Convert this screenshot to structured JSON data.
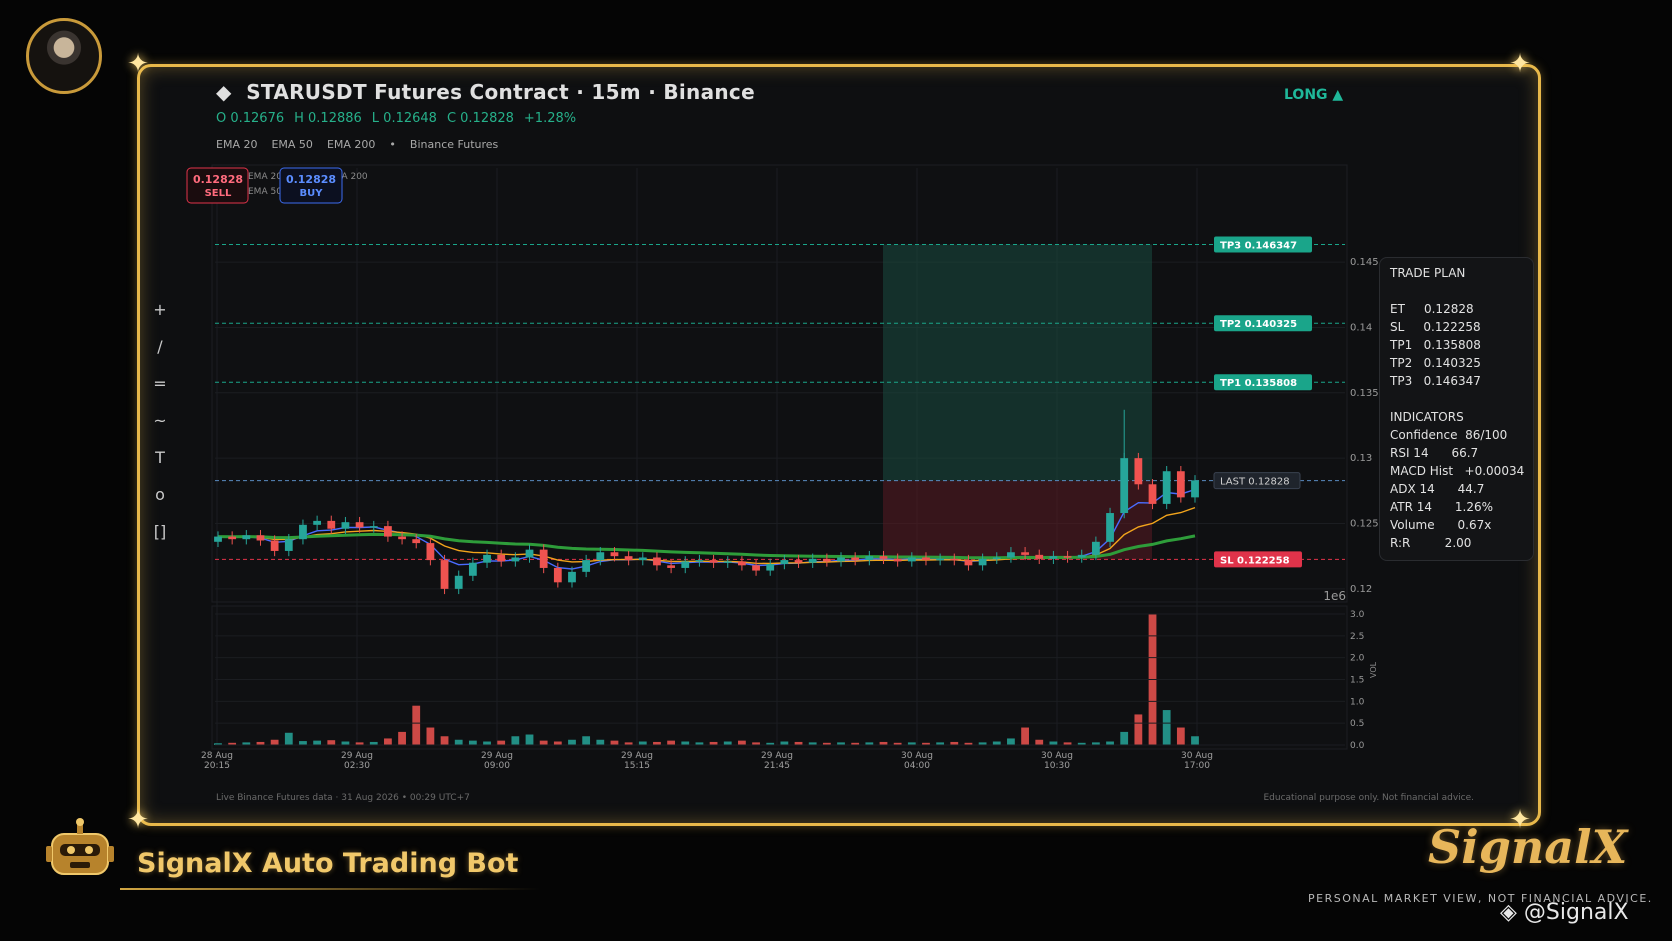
{
  "header": {
    "title": "STARUSDT Futures Contract  ·  15m  ·  Binance",
    "direction": "LONG ▲",
    "ohlc": {
      "o": "O 0.12676",
      "h": "H 0.12886",
      "l": "L 0.12648",
      "c": "C 0.12828",
      "chg": "+1.28%"
    },
    "legend": [
      "EMA 20",
      "EMA 50",
      "EMA 200",
      "•",
      "Binance Futures"
    ]
  },
  "toolbar": [
    "+",
    "/",
    "=",
    "~",
    "T",
    "o",
    "[]"
  ],
  "badges": {
    "sell_price": "0.12828",
    "sell_label": "SELL",
    "buy_price": "0.12828",
    "buy_label": "BUY",
    "ema_small": [
      "EMA 20",
      "EMA 50",
      "EMA 200"
    ]
  },
  "price_levels": {
    "tp3": {
      "label": "TP3  0.146347",
      "value": 0.146347
    },
    "tp2": {
      "label": "TP2  0.140325",
      "value": 0.140325
    },
    "tp1": {
      "label": "TP1  0.135808",
      "value": 0.135808
    },
    "last": {
      "label": "LAST  0.12828",
      "value": 0.12828
    },
    "sl": {
      "label": "SL  0.122258",
      "value": 0.122258
    }
  },
  "trade_plan": {
    "title": "TRADE PLAN",
    "rows": [
      "ET     0.12828",
      "SL     0.122258",
      "TP1   0.135808",
      "TP2   0.140325",
      "TP3   0.146347"
    ],
    "ind_title": "INDICATORS",
    "ind_rows": [
      "Confidence  86/100",
      "RSI 14      66.7",
      "MACD Hist   +0.00034",
      "ADX 14      44.7",
      "ATR 14      1.26%",
      "Volume      0.67x",
      "R:R         2.00"
    ]
  },
  "chart_data": {
    "type": "candlestick",
    "price_ticks": [
      0.12,
      0.125,
      0.13,
      0.135,
      0.14,
      0.145
    ],
    "price_range": [
      0.1193,
      0.1522
    ],
    "volume_ticks": [
      "0.0",
      "0.5",
      "1.0",
      "1.5",
      "2.0",
      "2.5",
      "3.0"
    ],
    "volume_range": [
      0,
      3.0
    ],
    "volume_axis_label": "VOL",
    "volume_multiplier": "1e6",
    "x_ticks": [
      {
        "line1": "28 Aug",
        "line2": "20:15"
      },
      {
        "line1": "29 Aug",
        "line2": "02:30"
      },
      {
        "line1": "29 Aug",
        "line2": "09:00"
      },
      {
        "line1": "29 Aug",
        "line2": "15:15"
      },
      {
        "line1": "29 Aug",
        "line2": "21:45"
      },
      {
        "line1": "30 Aug",
        "line2": "04:00"
      },
      {
        "line1": "30 Aug",
        "line2": "10:30"
      },
      {
        "line1": "30 Aug",
        "line2": "17:00"
      }
    ],
    "candles_approx": [
      [
        0.1236,
        0.124
      ],
      [
        0.124,
        0.1238
      ],
      [
        0.1238,
        0.1241
      ],
      [
        0.1241,
        0.1237
      ],
      [
        0.1237,
        0.1229
      ],
      [
        0.1229,
        0.1238
      ],
      [
        0.1238,
        0.1249
      ],
      [
        0.1249,
        0.1252
      ],
      [
        0.1252,
        0.1246
      ],
      [
        0.1246,
        0.1251
      ],
      [
        0.1251,
        0.1247
      ],
      [
        0.1247,
        0.1248
      ],
      [
        0.1248,
        0.124
      ],
      [
        0.124,
        0.1238
      ],
      [
        0.1238,
        0.1235
      ],
      [
        0.1235,
        0.1222
      ],
      [
        0.1222,
        0.12
      ],
      [
        0.12,
        0.121
      ],
      [
        0.121,
        0.122
      ],
      [
        0.122,
        0.1226
      ],
      [
        0.1226,
        0.1221
      ],
      [
        0.1221,
        0.1224
      ],
      [
        0.1224,
        0.123
      ],
      [
        0.123,
        0.1216
      ],
      [
        0.1216,
        0.1205
      ],
      [
        0.1205,
        0.1213
      ],
      [
        0.1213,
        0.1222
      ],
      [
        0.1222,
        0.1228
      ],
      [
        0.1228,
        0.1225
      ],
      [
        0.1225,
        0.1222
      ],
      [
        0.1222,
        0.1224
      ],
      [
        0.1224,
        0.1218
      ],
      [
        0.1218,
        0.1216
      ],
      [
        0.1216,
        0.1221
      ],
      [
        0.1221,
        0.1222
      ],
      [
        0.1222,
        0.122
      ],
      [
        0.122,
        0.1221
      ],
      [
        0.1221,
        0.1218
      ],
      [
        0.1218,
        0.1214
      ],
      [
        0.1214,
        0.1219
      ],
      [
        0.1219,
        0.1222
      ],
      [
        0.1222,
        0.122
      ],
      [
        0.122,
        0.1223
      ],
      [
        0.1223,
        0.1221
      ],
      [
        0.1221,
        0.1224
      ],
      [
        0.1224,
        0.1222
      ],
      [
        0.1222,
        0.1225
      ],
      [
        0.1225,
        0.1223
      ],
      [
        0.1223,
        0.1221
      ],
      [
        0.1221,
        0.1224
      ],
      [
        0.1224,
        0.1222
      ],
      [
        0.1222,
        0.1223
      ],
      [
        0.1223,
        0.1222
      ],
      [
        0.1222,
        0.1218
      ],
      [
        0.1218,
        0.1223
      ],
      [
        0.1223,
        0.1224
      ],
      [
        0.1224,
        0.1228
      ],
      [
        0.1228,
        0.1226
      ],
      [
        0.1226,
        0.1223
      ],
      [
        0.1223,
        0.1225
      ],
      [
        0.1225,
        0.1224
      ],
      [
        0.1224,
        0.1226
      ],
      [
        0.1226,
        0.1236
      ],
      [
        0.1236,
        0.1258
      ],
      [
        0.1258,
        0.13
      ],
      [
        0.13,
        0.128
      ],
      [
        0.128,
        0.1265
      ],
      [
        0.1265,
        0.129
      ],
      [
        0.129,
        0.127
      ],
      [
        0.127,
        0.1283
      ]
    ],
    "volume_approx": [
      0.04,
      0.05,
      0.06,
      0.07,
      0.12,
      0.28,
      0.09,
      0.1,
      0.11,
      0.08,
      0.06,
      0.07,
      0.15,
      0.3,
      0.9,
      0.4,
      0.2,
      0.12,
      0.1,
      0.08,
      0.1,
      0.2,
      0.24,
      0.1,
      0.08,
      0.12,
      0.2,
      0.12,
      0.1,
      0.06,
      0.08,
      0.07,
      0.1,
      0.08,
      0.06,
      0.07,
      0.08,
      0.1,
      0.06,
      0.05,
      0.08,
      0.07,
      0.06,
      0.05,
      0.06,
      0.05,
      0.06,
      0.07,
      0.05,
      0.06,
      0.05,
      0.06,
      0.07,
      0.05,
      0.06,
      0.08,
      0.15,
      0.4,
      0.12,
      0.08,
      0.06,
      0.05,
      0.06,
      0.08,
      0.3,
      0.7,
      3.0,
      0.8,
      0.4,
      0.2
    ]
  },
  "footer": {
    "left": "Live Binance Futures data  ·  31 Aug 2026 • 00:29 UTC+7",
    "right": "Educational purpose only. Not financial advice."
  },
  "brand": {
    "name": "SignalX Auto Trading Bot",
    "logo": "SignalX",
    "disclaimer": "PERSONAL MARKET VIEW, NOT FINANCIAL ADVICE.",
    "handle": "@SignalX"
  },
  "colors": {
    "up": "#26a69a",
    "down": "#ef5350",
    "gold": "#e8b84a",
    "tp": "#1aa58a",
    "sl": "#e0334a"
  }
}
